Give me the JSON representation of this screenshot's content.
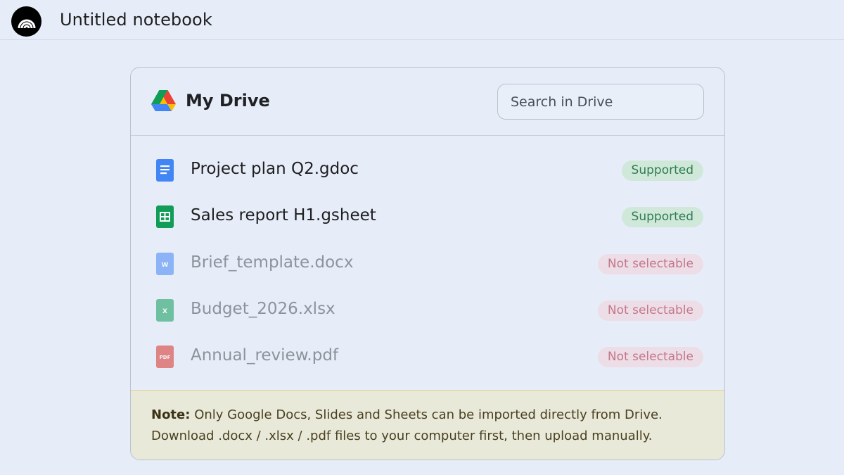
{
  "topbar": {
    "title": "Untitled notebook"
  },
  "dialog": {
    "title": "My Drive",
    "search": {
      "placeholder": "Search in Drive",
      "value": ""
    },
    "files": [
      {
        "name": "Project plan Q2.gdoc",
        "icon": "google-docs-icon",
        "status": "Supported",
        "selectable": true
      },
      {
        "name": "Sales report H1.gsheet",
        "icon": "google-sheets-icon",
        "status": "Supported",
        "selectable": true
      },
      {
        "name": "Brief_template.docx",
        "icon": "word-icon",
        "icon_text": "W",
        "status": "Not selectable",
        "selectable": false
      },
      {
        "name": "Budget_2026.xlsx",
        "icon": "excel-icon",
        "icon_text": "X",
        "status": "Not selectable",
        "selectable": false
      },
      {
        "name": "Annual_review.pdf",
        "icon": "pdf-icon",
        "icon_text": "PDF",
        "status": "Not selectable",
        "selectable": false
      }
    ],
    "note": {
      "label": "Note:",
      "line1": "Only Google Docs, Slides and Sheets can be imported directly from Drive.",
      "line2": "Download .docx / .xlsx / .pdf files to your computer first, then upload manually."
    }
  },
  "colors": {
    "background": "#e6edf9",
    "supported_badge_bg": "#d0e8da",
    "supported_badge_text": "#2e7d4f",
    "blocked_badge_bg": "#eddde6",
    "blocked_badge_text": "#c4778a",
    "docs_blue": "#4285f4",
    "sheets_green": "#0f9d58",
    "pdf_red": "#d93025"
  }
}
